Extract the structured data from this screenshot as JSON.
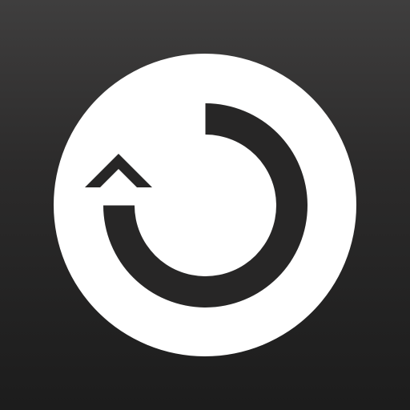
{
  "app_icon": {
    "icon": "refresh-icon",
    "colors": {
      "background_top": "#3f3e3e",
      "background_bottom": "#1c1c1c",
      "disc": "#ffffff",
      "glyph": "#272626"
    }
  }
}
